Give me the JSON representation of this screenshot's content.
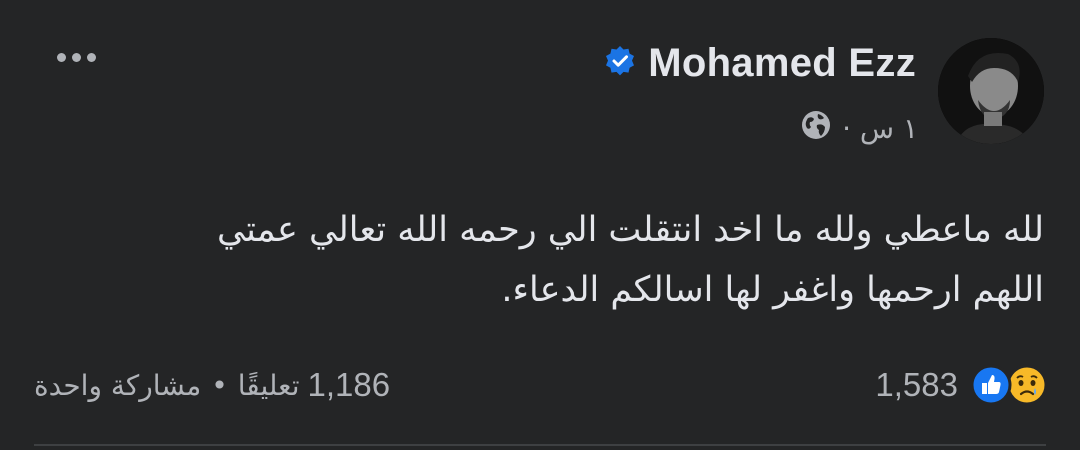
{
  "post": {
    "author": "Mohamed Ezz",
    "verified": true,
    "time": "١ س ·",
    "audience_icon": "globe-icon",
    "text_lines": [
      "لله ماعطي ولله ما اخد انتقلت الي رحمه الله تعالي عمتي",
      "اللهم ارحمها واغفر لها اسالكم الدعاء."
    ]
  },
  "reactions": {
    "count": "1,583",
    "icons": [
      "like-icon",
      "sad-icon"
    ]
  },
  "stats": {
    "comments": "تعليقًا",
    "comments_count": "1,186",
    "separator": "•",
    "shares": "مشاركة واحدة"
  },
  "colors": {
    "background": "#242526",
    "primary_text": "#e4e6eb",
    "secondary_text": "#b0b3b8",
    "verified_blue": "#1b74e4",
    "like_blue": "#1877f2",
    "sad_yellow": "#f7b928"
  }
}
